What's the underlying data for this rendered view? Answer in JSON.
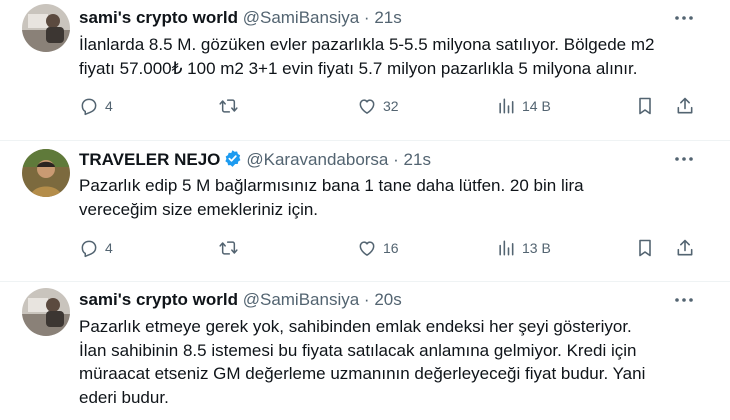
{
  "tweets": [
    {
      "name": "sami's crypto world",
      "handle": "@SamiBansiya",
      "sep": "·",
      "time": "21s",
      "verified": false,
      "text_lines": [
        "İlanlarda 8.5 M. gözüken evler pazarlıkla 5-5.5 milyona satılıyor. Bölgede m2",
        "fiyatı 57.000₺  100 m2 3+1 evin fiyatı 5.7 milyon pazarlıkla 5 milyona alınır."
      ],
      "replies": "4",
      "retweets": "",
      "likes": "32",
      "views": "14 B"
    },
    {
      "name": "TRAVELER NEJO",
      "handle": "@Karavandaborsa",
      "sep": "·",
      "time": "21s",
      "verified": true,
      "text_lines": [
        "Pazarlık edip 5 M bağlarmısınız bana 1 tane daha lütfen. 20 bin lira",
        "vereceğim size emekleriniz için."
      ],
      "replies": "4",
      "retweets": "",
      "likes": "16",
      "views": "13 B"
    },
    {
      "name": "sami's crypto world",
      "handle": "@SamiBansiya",
      "sep": "·",
      "time": "20s",
      "verified": false,
      "text_lines": [
        "Pazarlık etmeye gerek yok, sahibinden emlak endeksi her şeyi gösteriyor.",
        "İlan sahibinin 8.5 istemesi bu fiyata satılacak anlamına gelmiyor. Kredi için",
        "müraacat etseniz GM değerleme uzmanının değerleyeceği fiyat budur. Yani",
        "ederi budur."
      ]
    }
  ],
  "colors": {
    "text": "#0f1419",
    "muted": "#536471",
    "verified": "#1d9bf0",
    "divider": "#eff3f4"
  },
  "icons": [
    "more-icon",
    "reply-icon",
    "retweet-icon",
    "like-icon",
    "views-icon",
    "bookmark-icon",
    "share-icon",
    "verified-icon"
  ]
}
